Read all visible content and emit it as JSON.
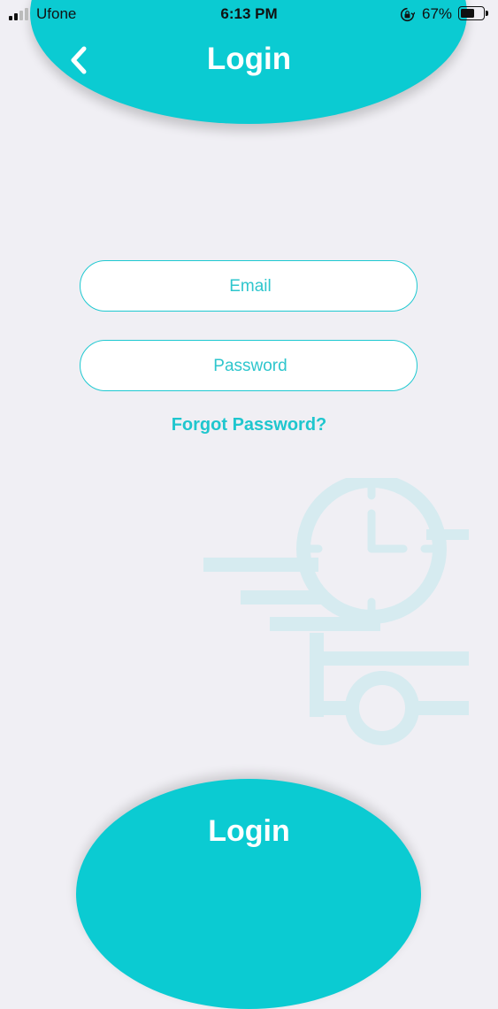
{
  "status_bar": {
    "carrier": "Ufone",
    "time": "6:13 PM",
    "battery_percent": "67%",
    "battery_level": 0.67,
    "icons": [
      "signal-icon",
      "orientation-lock-icon",
      "battery-icon"
    ]
  },
  "header": {
    "title": "Login",
    "back_icon": "chevron-left-icon"
  },
  "form": {
    "email_placeholder": "Email",
    "email_value": "",
    "password_placeholder": "Password",
    "password_value": "",
    "forgot_label": "Forgot Password?"
  },
  "decoration": {
    "icon": "fast-delivery-clock-icon"
  },
  "login_button": {
    "label": "Login"
  },
  "colors": {
    "accent": "#0bcbd2",
    "accent_text": "#1fc6ce",
    "background": "#f0eff4",
    "illustration": "#d6ebf0"
  }
}
